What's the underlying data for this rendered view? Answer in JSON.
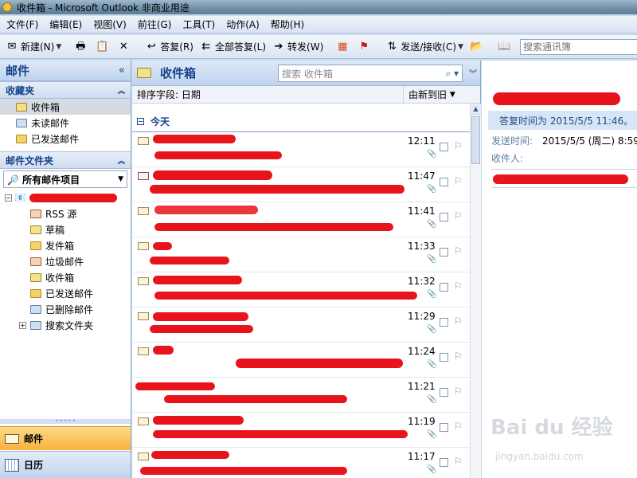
{
  "window": {
    "title": "收件箱 - Microsoft Outlook 非商业用途"
  },
  "menu": [
    "文件(F)",
    "编辑(E)",
    "视图(V)",
    "前往(G)",
    "工具(T)",
    "动作(A)",
    "帮助(H)"
  ],
  "toolbar": {
    "new_label": "新建(N)",
    "reply_label": "答复(R)",
    "reply_all_label": "全部答复(L)",
    "forward_label": "转发(W)",
    "send_receive_label": "发送/接收(C)",
    "search_contacts_placeholder": "搜索通讯簿"
  },
  "nav": {
    "title": "邮件",
    "favorites_title": "收藏夹",
    "favorites": [
      {
        "label": "收件箱",
        "selected": true
      },
      {
        "label": "未读邮件"
      },
      {
        "label": "已发送邮件"
      }
    ],
    "folders_title": "邮件文件夹",
    "all_items_label": "所有邮件项目",
    "folders": [
      {
        "label": "RSS 源"
      },
      {
        "label": "草稿"
      },
      {
        "label": "发件箱"
      },
      {
        "label": "垃圾邮件"
      },
      {
        "label": "收件箱"
      },
      {
        "label": "已发送邮件"
      },
      {
        "label": "已删除邮件"
      }
    ],
    "search_folders_label": "搜索文件夹",
    "mail_button": "邮件",
    "calendar_button": "日历"
  },
  "list": {
    "title": "收件箱",
    "search_placeholder": "搜索 收件箱",
    "arranged_by": "排序字段: 日期",
    "sort_order": "由新到旧",
    "group_label": "今天",
    "messages": [
      {
        "time": "12:11"
      },
      {
        "time": "11:47"
      },
      {
        "time": "11:41"
      },
      {
        "time": "11:33"
      },
      {
        "time": "11:32"
      },
      {
        "time": "11:29"
      },
      {
        "time": "11:24"
      },
      {
        "time": "11:21"
      },
      {
        "time": "11:19"
      },
      {
        "time": "11:17"
      }
    ]
  },
  "reading": {
    "reply_info": "答复时间为 2015/5/5 11:46。",
    "sent_label": "发送时间:",
    "sent_value": "2015/5/5 (周二) 8:59",
    "to_label": "收件人:"
  },
  "watermark": {
    "brand": "Bai du 经验",
    "site": "jingyan.baidu.com"
  }
}
